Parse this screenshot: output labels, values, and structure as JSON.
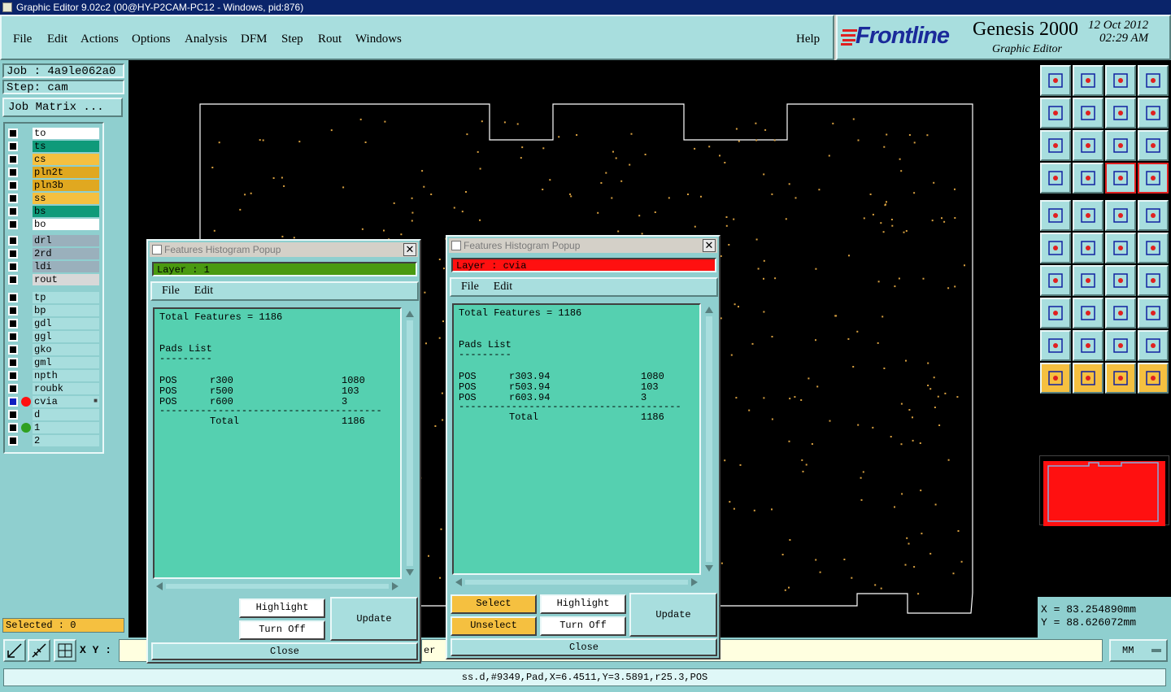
{
  "window": {
    "title": "Graphic Editor 9.02c2 (00@HY-P2CAM-PC12 - Windows, pid:876)"
  },
  "menubar": {
    "items": [
      "File",
      "Edit",
      "Actions",
      "Options",
      "Analysis",
      "DFM",
      "Step",
      "Rout",
      "Windows"
    ],
    "help": "Help"
  },
  "brand": {
    "logo": "Frontline",
    "product": "Genesis 2000",
    "subtitle": "Graphic Editor",
    "date": "12 Oct 2012",
    "time": "02:29 AM"
  },
  "job": {
    "job_label": "Job : 4a9le062a0",
    "step_label": "Step: cam",
    "matrix_button": "Job Matrix ..."
  },
  "layers": {
    "group1": [
      {
        "name": "to",
        "color": "#ffffff"
      },
      {
        "name": "ts",
        "color": "#0f9a7a"
      },
      {
        "name": "cs",
        "color": "#f5c040"
      },
      {
        "name": "pln2t",
        "color": "#e0a820"
      },
      {
        "name": "pln3b",
        "color": "#e0a820"
      },
      {
        "name": "ss",
        "color": "#f5c040"
      },
      {
        "name": "bs",
        "color": "#0f9a7a"
      },
      {
        "name": "bo",
        "color": "#ffffff"
      }
    ],
    "group2": [
      {
        "name": "drl",
        "color": "#9ab0bc"
      },
      {
        "name": "2rd",
        "color": "#9ab0bc"
      },
      {
        "name": "ldi",
        "color": "#9ab0bc"
      },
      {
        "name": "rout",
        "color": "#d8d8d8"
      }
    ],
    "group3": [
      {
        "name": "tp",
        "color": "#a8dede"
      },
      {
        "name": "bp",
        "color": "#a8dede"
      },
      {
        "name": "gdl",
        "color": "#a8dede"
      },
      {
        "name": "ggl",
        "color": "#a8dede"
      },
      {
        "name": "gko",
        "color": "#a8dede"
      },
      {
        "name": "gml",
        "color": "#a8dede"
      },
      {
        "name": "npth",
        "color": "#a8dede"
      },
      {
        "name": "roubk",
        "color": "#a8dede"
      },
      {
        "name": "cvia",
        "color": "#a8dede"
      },
      {
        "name": "d",
        "color": "#a8dede"
      },
      {
        "name": "1",
        "color": "#a8dede"
      },
      {
        "name": "2",
        "color": "#a8dede"
      }
    ],
    "cvia_marker": "■"
  },
  "selected": "Selected : 0",
  "xy_label": "X Y :",
  "status_fragment": "er",
  "units": "MM",
  "coords": {
    "x": "X = 83.254890mm",
    "y": "Y = 88.626072mm"
  },
  "status_line": "ss.d,#9349,Pad,X=6.4511,Y=3.5891,r25.3,POS",
  "popup_left": {
    "title": "Features Histogram Popup",
    "layer": "Layer :  1",
    "layer_color": "#4a9a10",
    "menu": [
      "File",
      "Edit"
    ],
    "total": "Total Features = 1186",
    "pads_header": "Pads List",
    "pads_rule": "---------",
    "rows": [
      [
        "POS",
        "r300",
        "1080"
      ],
      [
        "POS",
        "r500",
        "103"
      ],
      [
        "POS",
        "r600",
        "3"
      ]
    ],
    "divider": "--------------------------------------",
    "total_label": "Total",
    "total_value": "1186",
    "highlight": "Highlight",
    "turn_off": "Turn Off",
    "update": "Update",
    "close": "Close"
  },
  "popup_right": {
    "title": "Features Histogram Popup",
    "layer": "Layer :  cvia",
    "layer_color": "#ff1010",
    "menu": [
      "File",
      "Edit"
    ],
    "total": "Total Features = 1186",
    "pads_header": "Pads List",
    "pads_rule": "---------",
    "rows": [
      [
        "POS",
        "r303.94",
        "1080"
      ],
      [
        "POS",
        "r503.94",
        "103"
      ],
      [
        "POS",
        "r603.94",
        "3"
      ]
    ],
    "divider": "--------------------------------------",
    "total_label": "Total",
    "total_value": "1186",
    "select": "Select",
    "unselect": "Unselect",
    "highlight": "Highlight",
    "turn_off": "Turn Off",
    "update": "Update",
    "close": "Close"
  }
}
